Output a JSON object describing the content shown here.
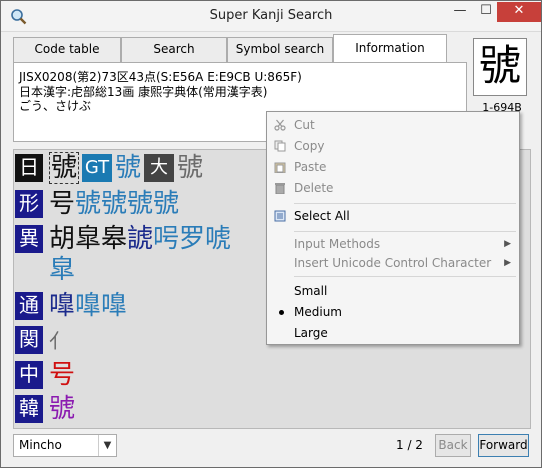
{
  "window": {
    "title": "Super Kanji Search",
    "controls": {
      "minimize": "—",
      "maximize": "☐",
      "close": "✕"
    }
  },
  "tabs": [
    "Code table",
    "Search",
    "Symbol search",
    "Information"
  ],
  "active_tab": "Information",
  "info": {
    "line1": "JISX0208(第2)73区43点(S:E56A E:E9CB U:865F)",
    "line2": "日本漢字:虍部総13画 康熙字典体(常用漢字表)",
    "line3": "ごう、さけぶ"
  },
  "kanji": {
    "char": "號",
    "code": "1-694B"
  },
  "variants": [
    {
      "badge": "日",
      "badge_style": "black",
      "chars": "號",
      "tag1": "GT",
      "gt_chars": "號",
      "tag2": "大",
      "da_chars": "號"
    },
    {
      "badge": "形",
      "chars_black": "号",
      "chars_blue": "號號號號"
    },
    {
      "badge": "異",
      "chars_black": "胡皐皋",
      "chars_navy": "諕",
      "chars_blue": "呺罗唬",
      "chars_blue_2": "皐"
    },
    {
      "badge": "通",
      "chars_navy": "嘷",
      "chars_blue": "嘷嘷"
    },
    {
      "badge": "関",
      "chars_gray": "⺅"
    },
    {
      "badge": "中",
      "chars_red": "号"
    },
    {
      "badge": "韓",
      "chars_purple": "號"
    }
  ],
  "bottom": {
    "font": "Mincho",
    "page": "1 / 2",
    "back": "Back",
    "forward": "Forward"
  },
  "context_menu": {
    "cut": "Cut",
    "copy": "Copy",
    "paste": "Paste",
    "delete": "Delete",
    "select_all": "Select All",
    "input_methods": "Input Methods",
    "insert_unicode": "Insert Unicode Control Character",
    "small": "Small",
    "medium": "Medium",
    "large": "Large",
    "selected_size": "Medium"
  },
  "colors": {
    "badge_blue": "#1a1a8c",
    "tag_gt": "#1b7ab2",
    "char_blue": "#2a7cb8",
    "char_navy": "#1a2a8c",
    "char_red": "#d01010",
    "char_purple": "#8b1ab0",
    "close_red": "#c7403a"
  }
}
